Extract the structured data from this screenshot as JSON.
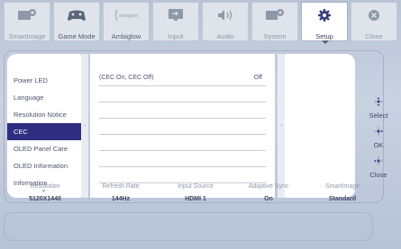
{
  "tabs": [
    {
      "label": "SmartImage",
      "icon": "smartimage-icon",
      "selected": false
    },
    {
      "label": "Game Mode",
      "icon": "gamepad-icon",
      "selected": false
    },
    {
      "label": "Ambiglow",
      "icon": "ambiglow-icon",
      "icon_text": "ambiglow",
      "selected": false
    },
    {
      "label": "Input",
      "icon": "input-icon",
      "selected": false
    },
    {
      "label": "Audio",
      "icon": "speaker-icon",
      "selected": false
    },
    {
      "label": "System",
      "icon": "system-icon",
      "selected": false
    },
    {
      "label": "Setup",
      "icon": "gear-icon",
      "selected": true
    },
    {
      "label": "Close",
      "icon": "close-icon",
      "selected": false
    }
  ],
  "menu": {
    "items": [
      "Power LED",
      "Language",
      "Resolution Notice",
      "CEC",
      "OLED Panel Care",
      "OLED Information",
      "Information"
    ],
    "active_index": 3
  },
  "options": {
    "description": "(CEC On, CEC Off)",
    "value": "Off"
  },
  "controls": {
    "select": "Select",
    "ok": "OK",
    "close": "Close"
  },
  "status": [
    {
      "key": "Resolution",
      "value": "5120X1440"
    },
    {
      "key": "Refresh Rate",
      "value": "144Hz"
    },
    {
      "key": "Input Source",
      "value": "HDMI 1"
    },
    {
      "key": "Adaptive Sync",
      "value": "On"
    },
    {
      "key": "SmartImage",
      "value": "Standard"
    }
  ],
  "colors": {
    "accent": "#2f2d82",
    "background": "#c3cddd"
  }
}
